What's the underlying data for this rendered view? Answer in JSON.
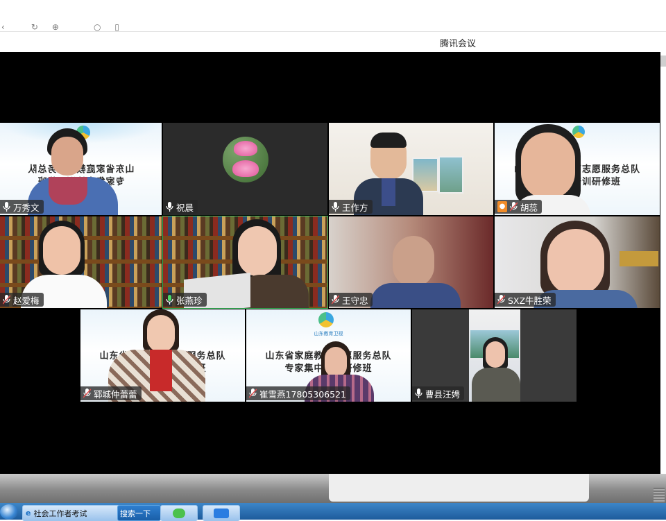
{
  "window": {
    "title": "腾讯会议"
  },
  "topbar": {
    "icons": [
      "back-icon",
      "refresh-icon",
      "globe-icon",
      "search-icon",
      "bookmark-icon"
    ]
  },
  "participants": [
    {
      "name": "万秀文",
      "mic": "on",
      "banner": [
        "山东省家庭教育服务总队",
        "专家集中培训研修班"
      ]
    },
    {
      "name": "祝晨",
      "mic": "on",
      "avatar": "lotus"
    },
    {
      "name": "王作方",
      "mic": "on"
    },
    {
      "name": "胡蕊",
      "mic": "muted",
      "avatar_badge": "person-icon",
      "banner": [
        "山东省家庭教育志愿服务总队",
        "专家集中培训研修班"
      ]
    },
    {
      "name": "赵爱梅",
      "mic": "muted"
    },
    {
      "name": "张燕珍",
      "mic": "speaking"
    },
    {
      "name": "王守忠",
      "mic": "muted"
    },
    {
      "name": "SXZ牛胜荣",
      "mic": "muted"
    },
    {
      "name": "郓城仲蕾蕾",
      "mic": "muted",
      "banner": [
        "山东省家庭教育志愿服务总队",
        "专家集中培训研修班"
      ]
    },
    {
      "name": "崔雪燕17805306521",
      "mic": "muted",
      "banner": [
        "山东省家庭教育志愿服务总队",
        "专家集中培训研修班"
      ],
      "logo_text": "山东教育卫视"
    },
    {
      "name": "曹县汪娉",
      "mic": "on"
    }
  ],
  "taskbar": {
    "items": [
      {
        "label": "社会工作者考试"
      },
      {
        "label": "搜索一下"
      }
    ]
  },
  "colors": {
    "stage": "#000000",
    "muted_mic": "#e05050",
    "speaking_mic": "#4cd964",
    "taskbar": "#2a6db0"
  }
}
